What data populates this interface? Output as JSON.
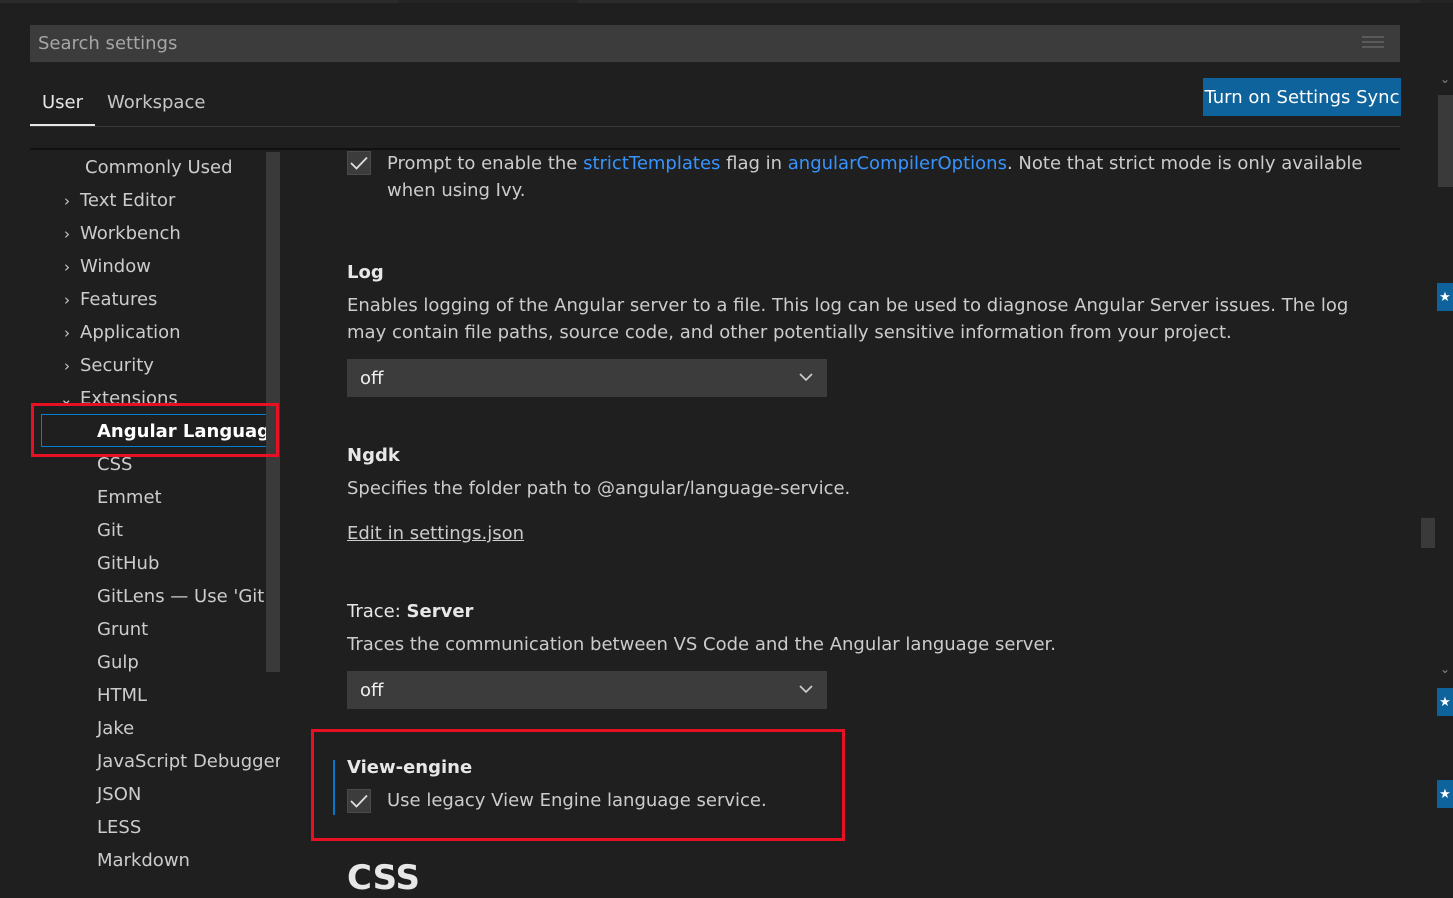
{
  "search": {
    "placeholder": "Search settings"
  },
  "tabs": [
    {
      "label": "User"
    },
    {
      "label": "Workspace"
    }
  ],
  "sync_button": {
    "label": "Turn on Settings Sync"
  },
  "toc": {
    "items": [
      {
        "label": "Commonly Used"
      },
      {
        "label": "Text Editor"
      },
      {
        "label": "Workbench"
      },
      {
        "label": "Window"
      },
      {
        "label": "Features"
      },
      {
        "label": "Application"
      },
      {
        "label": "Security"
      },
      {
        "label": "Extensions"
      },
      {
        "label": "Angular Languag..."
      },
      {
        "label": "CSS"
      },
      {
        "label": "Emmet"
      },
      {
        "label": "Git"
      },
      {
        "label": "GitHub"
      },
      {
        "label": "GitLens — Use 'Git..."
      },
      {
        "label": "Grunt"
      },
      {
        "label": "Gulp"
      },
      {
        "label": "HTML"
      },
      {
        "label": "Jake"
      },
      {
        "label": "JavaScript Debugger"
      },
      {
        "label": "JSON"
      },
      {
        "label": "LESS"
      },
      {
        "label": "Markdown"
      }
    ]
  },
  "settings": {
    "strict": {
      "text_before": "Prompt to enable the ",
      "link1": "strictTemplates",
      "text_mid": " flag in ",
      "link2": "angularCompilerOptions",
      "text_after": ". Note that strict mode is only available when using Ivy."
    },
    "log": {
      "title": "Log",
      "description": "Enables logging of the Angular server to a file. This log can be used to diagnose Angular Server issues. The log may contain file paths, source code, and other potentially sensitive information from your project.",
      "value": "off"
    },
    "ngdk": {
      "title": "Ngdk",
      "description": "Specifies the folder path to @angular/language-service.",
      "edit_link": "Edit in settings.json"
    },
    "trace": {
      "category": "Trace: ",
      "title": "Server",
      "description": "Traces the communication between VS Code and the Angular language server.",
      "value": "off"
    },
    "view_engine": {
      "title": "View-engine",
      "description": "Use legacy View Engine language service."
    }
  },
  "section_heading": "CSS"
}
